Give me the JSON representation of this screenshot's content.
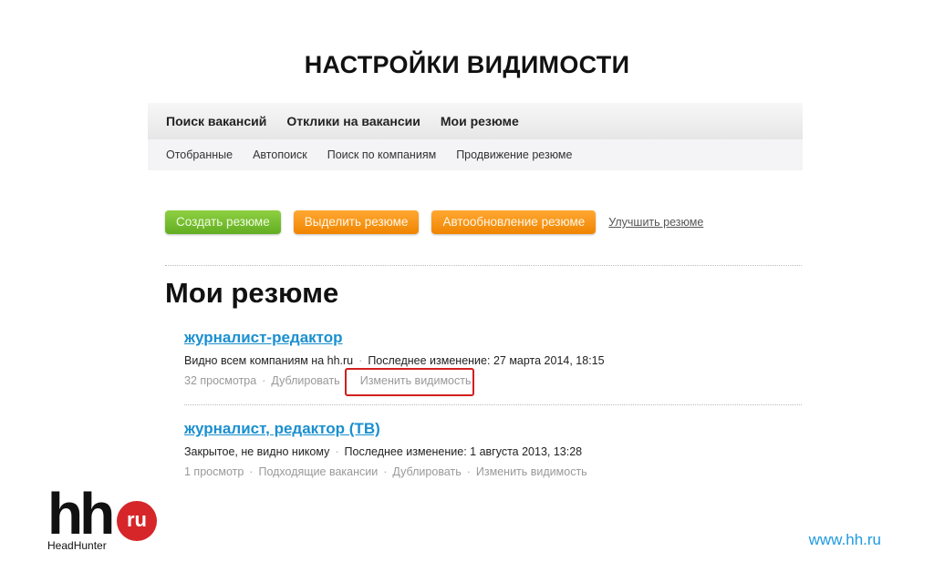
{
  "slide": {
    "title": "НАСТРОЙКИ ВИДИМОСТИ",
    "website": "www.hh.ru"
  },
  "nav": {
    "top": [
      "Поиск вакансий",
      "Отклики на вакансии",
      "Мои резюме"
    ],
    "sub": [
      "Отобранные",
      "Автопоиск",
      "Поиск по компаниям",
      "Продвижение резюме"
    ]
  },
  "actions": {
    "create": "Создать резюме",
    "highlight": "Выделить резюме",
    "autoupdate": "Автообновление резюме",
    "improve": "Улучшить резюме"
  },
  "heading": "Мои резюме",
  "resumes": [
    {
      "title": "журналист-редактор",
      "visibility": "Видно всем компаниям на hh.ru",
      "modified": "Последнее изменение: 27 марта 2014, 18:15",
      "views": "32 просмотра",
      "duplicate": "Дублировать",
      "change_visibility": "Изменить видимость"
    },
    {
      "title": "журналист, редактор (ТВ)",
      "visibility": "Закрытое, не видно никому",
      "modified": "Последнее изменение: 1 августа 2013, 13:28",
      "views": "1 просмотр",
      "matching": "Подходящие вакансии",
      "duplicate": "Дублировать",
      "change_visibility": "Изменить видимость"
    }
  ],
  "logo": {
    "main": "hh",
    "badge": "ru",
    "sub": "HeadHunter"
  },
  "colors": {
    "green": "#6cb82a",
    "orange": "#f79410",
    "link": "#1a8fcf",
    "highlight": "#d21f1f",
    "logo_red": "#d6262a"
  }
}
